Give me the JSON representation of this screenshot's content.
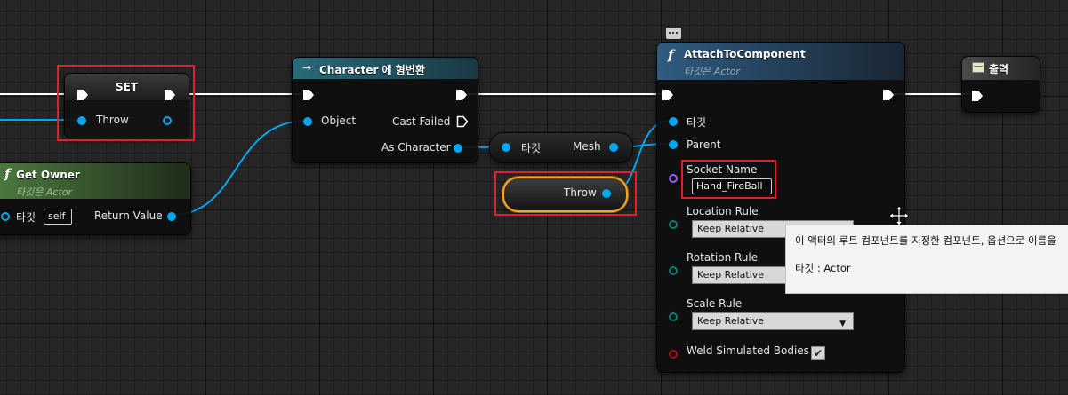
{
  "set_node": {
    "title": "SET",
    "var_label": "Throw"
  },
  "cast_node": {
    "title": "Character 에 형변환",
    "object_label": "Object",
    "cast_failed_label": "Cast Failed",
    "as_character_label": "As Character"
  },
  "get_owner_node": {
    "title": "Get Owner",
    "subtitle": "타깃은 Actor",
    "target_label": "타깃",
    "self_value": "self",
    "return_label": "Return Value"
  },
  "mesh_node": {
    "target_label": "타깃",
    "mesh_label": "Mesh"
  },
  "throw_getter": {
    "label": "Throw"
  },
  "attach_node": {
    "title": "AttachToComponent",
    "subtitle": "타깃은 Actor",
    "target_label": "타깃",
    "parent_label": "Parent",
    "socket_name_label": "Socket Name",
    "socket_name_value": "Hand_FireBall",
    "location_rule_label": "Location Rule",
    "location_rule_value": "Keep Relative",
    "rotation_rule_label": "Rotation Rule",
    "rotation_rule_value": "Keep Relative",
    "scale_rule_label": "Scale Rule",
    "scale_rule_value": "Keep Relative",
    "weld_label": "Weld Simulated Bodies",
    "weld_checked": true,
    "weld_check_glyph": "✔"
  },
  "output_node": {
    "title": "출력"
  },
  "tooltip": {
    "line1": "이 액터의 루트 컴포넌트를 지정한 컴포넌트, 옵션으로 이름을",
    "line2": "타깃 : Actor"
  },
  "icons": [
    "exec-pin-icon",
    "data-pin-icon",
    "function-icon",
    "cast-arrow-icon",
    "move-cursor-icon",
    "comment-bubble-icon",
    "output-icon",
    "checkbox-icon"
  ],
  "colors": {
    "exec": "#ffffff",
    "object_pin": "#00a7f0",
    "name_pin": "#9b59ff",
    "enum_pin": "#00806f",
    "bool_pin": "#a41010",
    "highlight": "#e01f26",
    "selection": "#f5a623",
    "function_header": "#2a4d6b",
    "cast_header": "#1f4a58",
    "getowner_header": "#2e5a2a"
  }
}
